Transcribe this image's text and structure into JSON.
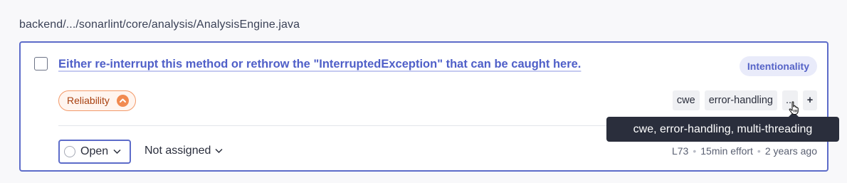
{
  "file_path": "backend/.../sonarlint/core/analysis/AnalysisEngine.java",
  "issue": {
    "title": "Either re-interrupt this method or rethrow the \"InterruptedException\" that can be caught here.",
    "quality_tag": "Intentionality",
    "impact": "Reliability",
    "impact_color": "#f18a50",
    "tags": [
      "cwe",
      "error-handling"
    ],
    "more_tags_label": "...",
    "add_tag_label": "+",
    "status": "Open",
    "assignee": "Not assigned",
    "line": "L73",
    "effort": "15min effort",
    "age": "2 years ago"
  },
  "tooltip": {
    "text": "cwe, error-handling, multi-threading"
  },
  "colors": {
    "accent": "#5d6cc9",
    "title_link": "#4f5fc8",
    "tooltip_bg": "#2a2e3c"
  }
}
